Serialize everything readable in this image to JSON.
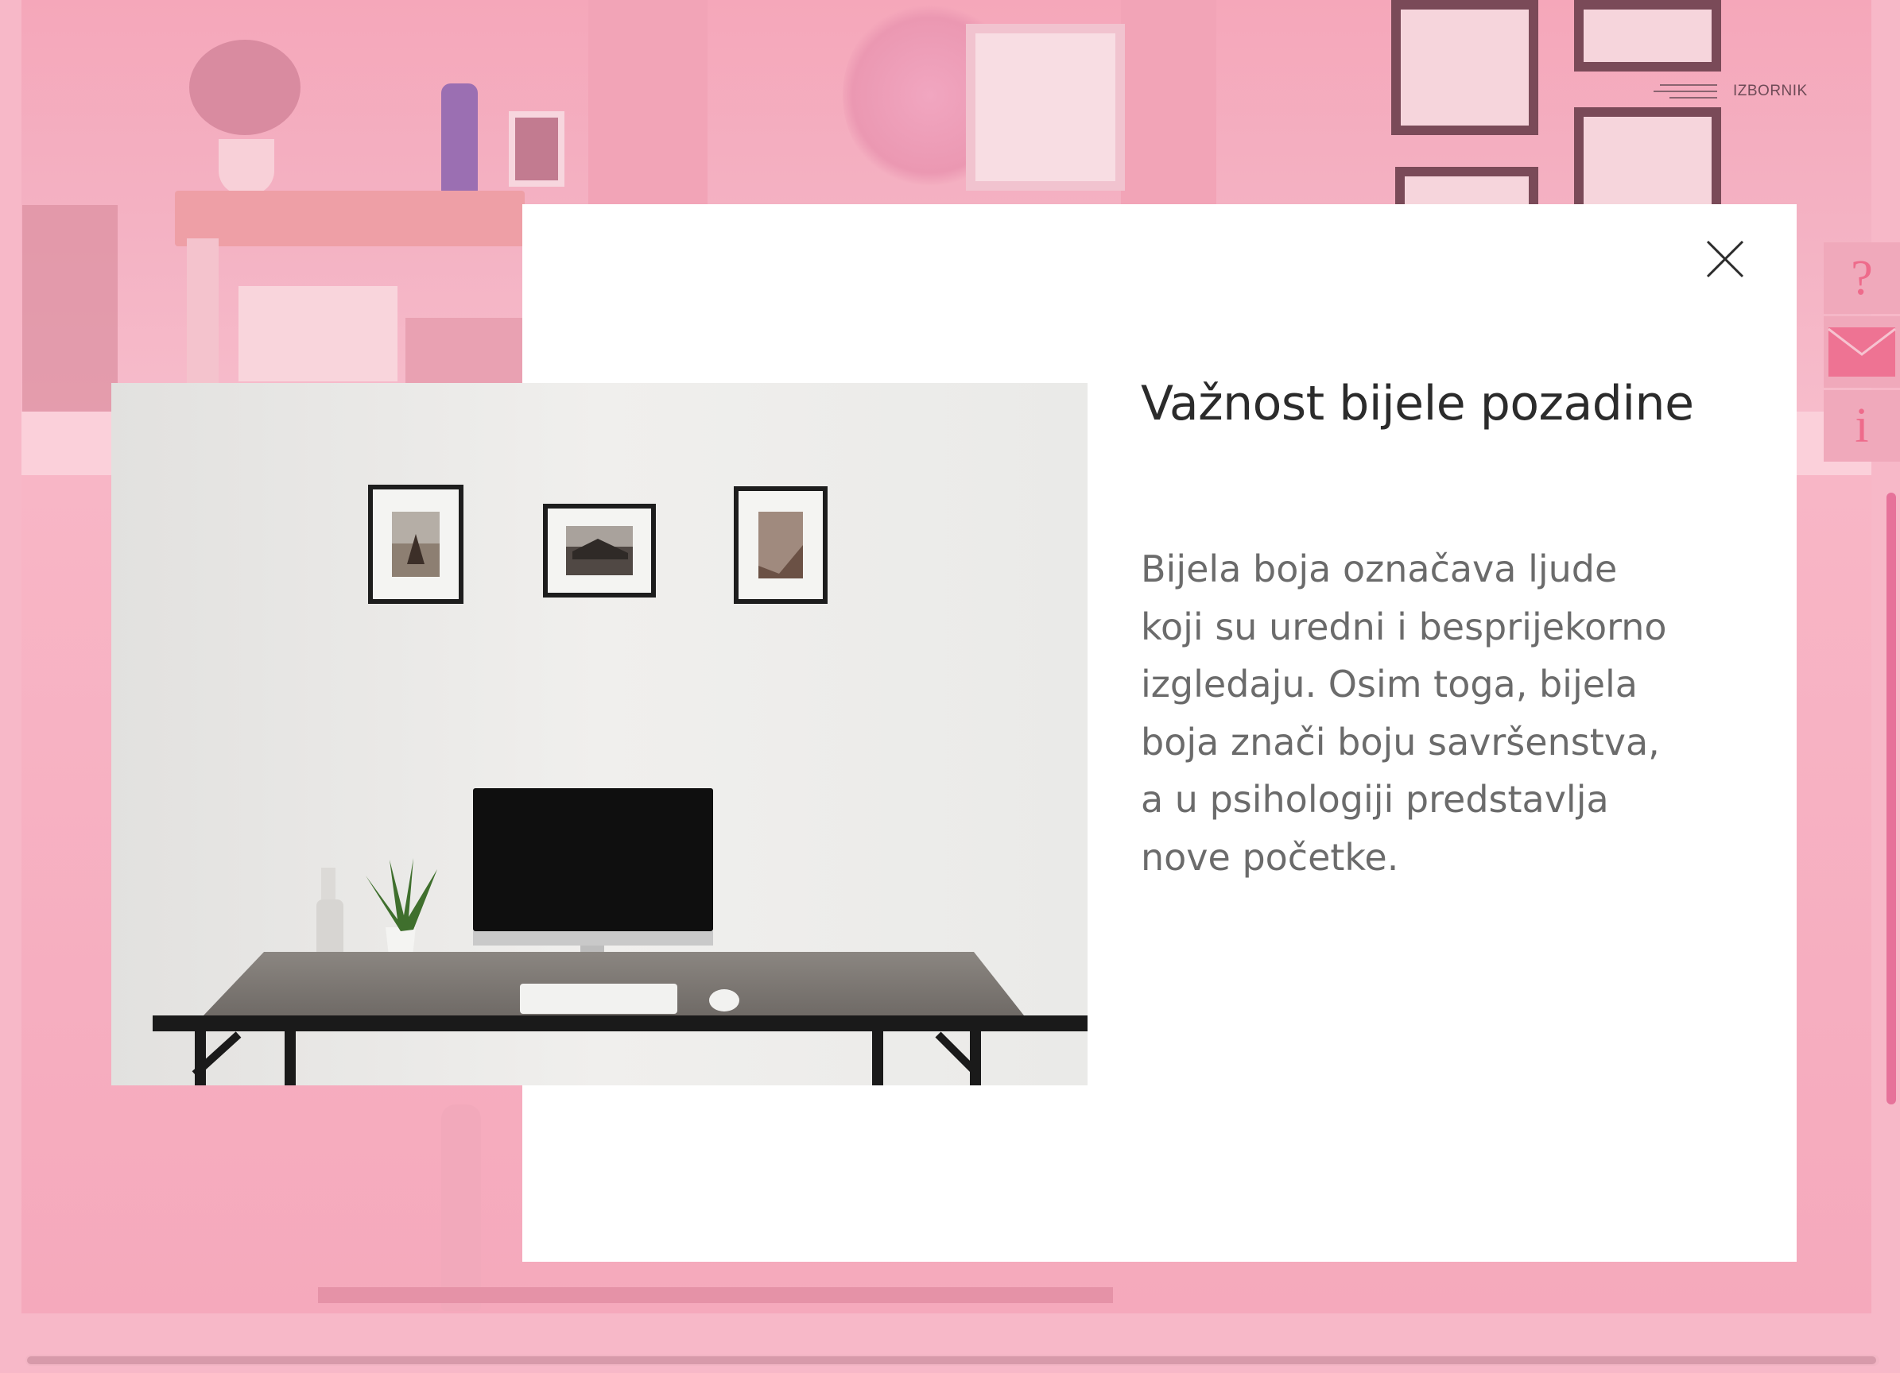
{
  "menu": {
    "label": "IZBORNIK"
  },
  "side_buttons": [
    {
      "name": "help",
      "glyph": "?",
      "icon": "question-icon"
    },
    {
      "name": "contact",
      "glyph": "",
      "icon": "mail-icon"
    },
    {
      "name": "info",
      "glyph": "i",
      "icon": "info-icon"
    }
  ],
  "modal": {
    "title": "Važnost bijele pozadine",
    "body_lines": [
      "Bijela boja označava ljude",
      "koji su uredni i besprijekorno",
      "izgledaju. Osim toga, bijela",
      "boja znači boju savršenstva,",
      "a u psihologiji predstavlja",
      "nove početke."
    ],
    "close_icon": "close-icon",
    "image_subject": "desk-scene"
  },
  "colors": {
    "overlay_pink": "#f7b8c8",
    "accent_pink": "#ee6b8b",
    "modal_bg": "#ffffff",
    "title_text": "#2b2b2b",
    "body_text": "#6b6b6b"
  }
}
